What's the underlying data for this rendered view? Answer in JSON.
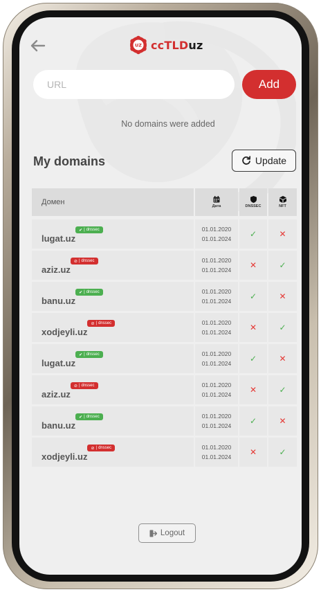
{
  "header": {
    "back_icon": "arrow-left-icon",
    "logo_badge": "UZ",
    "logo_cc": "cc",
    "logo_tld": "TLD",
    "logo_uz": "uz"
  },
  "add_form": {
    "url_placeholder": "URL",
    "add_label": "Add"
  },
  "empty_message": "No domains were added",
  "my_domains": {
    "title": "My domains",
    "update_label": "Update",
    "update_icon": "refresh-icon"
  },
  "table": {
    "headers": {
      "domain": "Домен",
      "date": "Дата",
      "dnssec": "DNSSEC",
      "nft": "NFT"
    },
    "rows": [
      {
        "domain": "lugat.uz",
        "badge": "dnssec",
        "dnssec_ok": true,
        "registered": "01.01.2020",
        "expires": "01.01.2024",
        "dnssec_mark": "✓",
        "nft_mark": "✕"
      },
      {
        "domain": "aziz.uz",
        "badge": "dnssec",
        "dnssec_ok": false,
        "registered": "01.01.2020",
        "expires": "01.01.2024",
        "dnssec_mark": "✕",
        "nft_mark": "✓"
      },
      {
        "domain": "banu.uz",
        "badge": "dnssec",
        "dnssec_ok": true,
        "registered": "01.01.2020",
        "expires": "01.01.2024",
        "dnssec_mark": "✓",
        "nft_mark": "✕"
      },
      {
        "domain": "xodjeyli.uz",
        "badge": "dnssec",
        "dnssec_ok": false,
        "registered": "01.01.2020",
        "expires": "01.01.2024",
        "dnssec_mark": "✕",
        "nft_mark": "✓"
      },
      {
        "domain": "lugat.uz",
        "badge": "dnssec",
        "dnssec_ok": true,
        "registered": "01.01.2020",
        "expires": "01.01.2024",
        "dnssec_mark": "✓",
        "nft_mark": "✕"
      },
      {
        "domain": "aziz.uz",
        "badge": "dnssec",
        "dnssec_ok": false,
        "registered": "01.01.2020",
        "expires": "01.01.2024",
        "dnssec_mark": "✕",
        "nft_mark": "✓"
      },
      {
        "domain": "banu.uz",
        "badge": "dnssec",
        "dnssec_ok": true,
        "registered": "01.01.2020",
        "expires": "01.01.2024",
        "dnssec_mark": "✓",
        "nft_mark": "✕"
      },
      {
        "domain": "xodjeyli.uz",
        "badge": "dnssec",
        "dnssec_ok": false,
        "registered": "01.01.2020",
        "expires": "01.01.2024",
        "dnssec_mark": "✕",
        "nft_mark": "✓"
      }
    ]
  },
  "logout": {
    "label": "Logout",
    "icon": "logout-icon"
  },
  "colors": {
    "accent": "#d32f2f",
    "success": "#4caf50",
    "error": "#e53935",
    "screen_bg": "#efefef"
  }
}
